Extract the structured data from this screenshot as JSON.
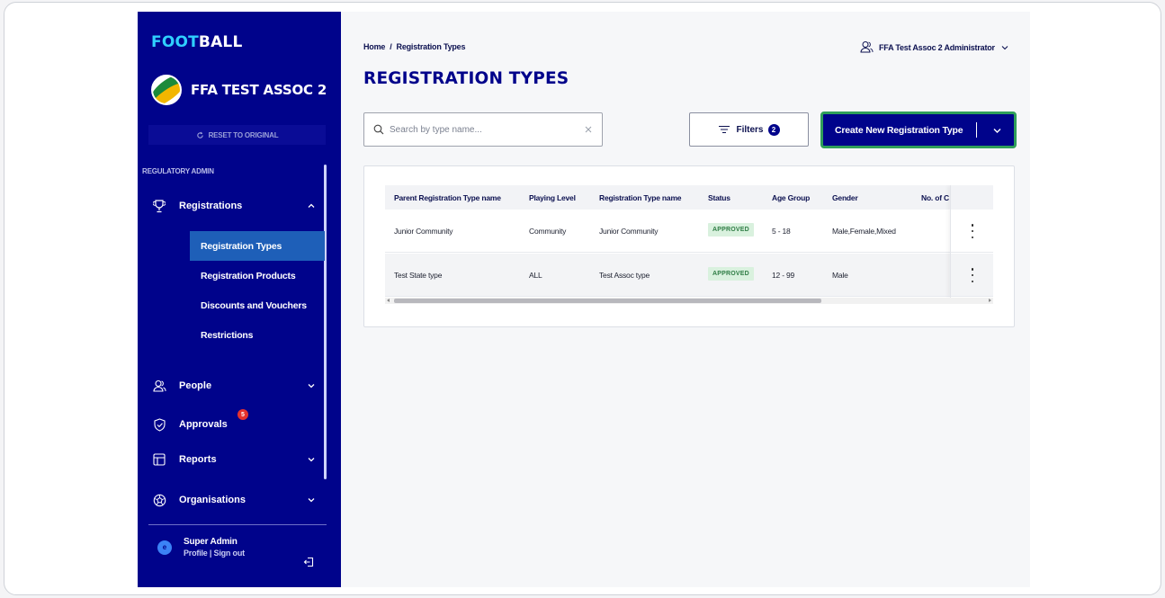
{
  "sidebar": {
    "brand_part1": "FOOT",
    "brand_part2": "BALL",
    "org_name": "FFA TEST ASSOC 2",
    "reset_label": "RESET TO ORIGINAL",
    "section_label": "REGULATORY ADMIN",
    "nav": {
      "registrations": "Registrations",
      "people": "People",
      "approvals": "Approvals",
      "approvals_badge": "5",
      "reports": "Reports",
      "organisations": "Organisations"
    },
    "sub_items": [
      "Registration Types",
      "Registration Products",
      "Discounts and Vouchers",
      "Restrictions"
    ],
    "user": {
      "avatar_initial": "e",
      "name": "Super Admin",
      "links": "Profile | Sign out"
    }
  },
  "header": {
    "breadcrumb_home": "Home",
    "breadcrumb_sep": "/",
    "breadcrumb_current": "Registration Types",
    "user_menu": "FFA Test Assoc 2 Administrator"
  },
  "page": {
    "title": "REGISTRATION TYPES",
    "search_placeholder": "Search by type name...",
    "filters_label": "Filters",
    "filters_count": "2",
    "create_label": "Create New Registration Type"
  },
  "table": {
    "columns": [
      "Parent Registration Type name",
      "Playing Level",
      "Registration Type name",
      "Status",
      "Age Group",
      "Gender",
      "No. of C"
    ],
    "rows": [
      [
        "Junior Community",
        "Community",
        "Junior Community",
        "APPROVED",
        "5 - 18",
        "Male,Female,Mixed"
      ],
      [
        "Test State type",
        "ALL",
        "Test Assoc type",
        "APPROVED",
        "12 - 99",
        "Male"
      ]
    ]
  },
  "colors": {
    "sidebar_bg": "#00038b",
    "active_item": "#1e5fb8",
    "accent_border": "#2f9e5a",
    "brand_cyan": "#2fd0ff",
    "badge_red": "#e5322d"
  }
}
